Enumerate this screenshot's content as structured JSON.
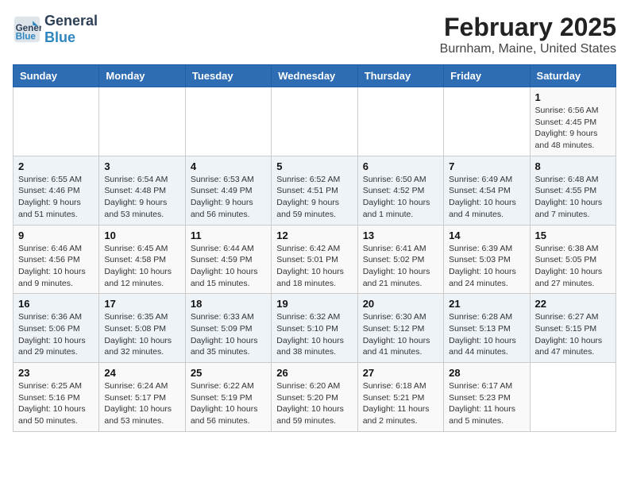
{
  "header": {
    "logo_general": "General",
    "logo_blue": "Blue",
    "title": "February 2025",
    "subtitle": "Burnham, Maine, United States"
  },
  "days_of_week": [
    "Sunday",
    "Monday",
    "Tuesday",
    "Wednesday",
    "Thursday",
    "Friday",
    "Saturday"
  ],
  "weeks": [
    [
      {
        "day": "",
        "detail": ""
      },
      {
        "day": "",
        "detail": ""
      },
      {
        "day": "",
        "detail": ""
      },
      {
        "day": "",
        "detail": ""
      },
      {
        "day": "",
        "detail": ""
      },
      {
        "day": "",
        "detail": ""
      },
      {
        "day": "1",
        "detail": "Sunrise: 6:56 AM\nSunset: 4:45 PM\nDaylight: 9 hours and 48 minutes."
      }
    ],
    [
      {
        "day": "2",
        "detail": "Sunrise: 6:55 AM\nSunset: 4:46 PM\nDaylight: 9 hours and 51 minutes."
      },
      {
        "day": "3",
        "detail": "Sunrise: 6:54 AM\nSunset: 4:48 PM\nDaylight: 9 hours and 53 minutes."
      },
      {
        "day": "4",
        "detail": "Sunrise: 6:53 AM\nSunset: 4:49 PM\nDaylight: 9 hours and 56 minutes."
      },
      {
        "day": "5",
        "detail": "Sunrise: 6:52 AM\nSunset: 4:51 PM\nDaylight: 9 hours and 59 minutes."
      },
      {
        "day": "6",
        "detail": "Sunrise: 6:50 AM\nSunset: 4:52 PM\nDaylight: 10 hours and 1 minute."
      },
      {
        "day": "7",
        "detail": "Sunrise: 6:49 AM\nSunset: 4:54 PM\nDaylight: 10 hours and 4 minutes."
      },
      {
        "day": "8",
        "detail": "Sunrise: 6:48 AM\nSunset: 4:55 PM\nDaylight: 10 hours and 7 minutes."
      }
    ],
    [
      {
        "day": "9",
        "detail": "Sunrise: 6:46 AM\nSunset: 4:56 PM\nDaylight: 10 hours and 9 minutes."
      },
      {
        "day": "10",
        "detail": "Sunrise: 6:45 AM\nSunset: 4:58 PM\nDaylight: 10 hours and 12 minutes."
      },
      {
        "day": "11",
        "detail": "Sunrise: 6:44 AM\nSunset: 4:59 PM\nDaylight: 10 hours and 15 minutes."
      },
      {
        "day": "12",
        "detail": "Sunrise: 6:42 AM\nSunset: 5:01 PM\nDaylight: 10 hours and 18 minutes."
      },
      {
        "day": "13",
        "detail": "Sunrise: 6:41 AM\nSunset: 5:02 PM\nDaylight: 10 hours and 21 minutes."
      },
      {
        "day": "14",
        "detail": "Sunrise: 6:39 AM\nSunset: 5:03 PM\nDaylight: 10 hours and 24 minutes."
      },
      {
        "day": "15",
        "detail": "Sunrise: 6:38 AM\nSunset: 5:05 PM\nDaylight: 10 hours and 27 minutes."
      }
    ],
    [
      {
        "day": "16",
        "detail": "Sunrise: 6:36 AM\nSunset: 5:06 PM\nDaylight: 10 hours and 29 minutes."
      },
      {
        "day": "17",
        "detail": "Sunrise: 6:35 AM\nSunset: 5:08 PM\nDaylight: 10 hours and 32 minutes."
      },
      {
        "day": "18",
        "detail": "Sunrise: 6:33 AM\nSunset: 5:09 PM\nDaylight: 10 hours and 35 minutes."
      },
      {
        "day": "19",
        "detail": "Sunrise: 6:32 AM\nSunset: 5:10 PM\nDaylight: 10 hours and 38 minutes."
      },
      {
        "day": "20",
        "detail": "Sunrise: 6:30 AM\nSunset: 5:12 PM\nDaylight: 10 hours and 41 minutes."
      },
      {
        "day": "21",
        "detail": "Sunrise: 6:28 AM\nSunset: 5:13 PM\nDaylight: 10 hours and 44 minutes."
      },
      {
        "day": "22",
        "detail": "Sunrise: 6:27 AM\nSunset: 5:15 PM\nDaylight: 10 hours and 47 minutes."
      }
    ],
    [
      {
        "day": "23",
        "detail": "Sunrise: 6:25 AM\nSunset: 5:16 PM\nDaylight: 10 hours and 50 minutes."
      },
      {
        "day": "24",
        "detail": "Sunrise: 6:24 AM\nSunset: 5:17 PM\nDaylight: 10 hours and 53 minutes."
      },
      {
        "day": "25",
        "detail": "Sunrise: 6:22 AM\nSunset: 5:19 PM\nDaylight: 10 hours and 56 minutes."
      },
      {
        "day": "26",
        "detail": "Sunrise: 6:20 AM\nSunset: 5:20 PM\nDaylight: 10 hours and 59 minutes."
      },
      {
        "day": "27",
        "detail": "Sunrise: 6:18 AM\nSunset: 5:21 PM\nDaylight: 11 hours and 2 minutes."
      },
      {
        "day": "28",
        "detail": "Sunrise: 6:17 AM\nSunset: 5:23 PM\nDaylight: 11 hours and 5 minutes."
      },
      {
        "day": "",
        "detail": ""
      }
    ]
  ]
}
